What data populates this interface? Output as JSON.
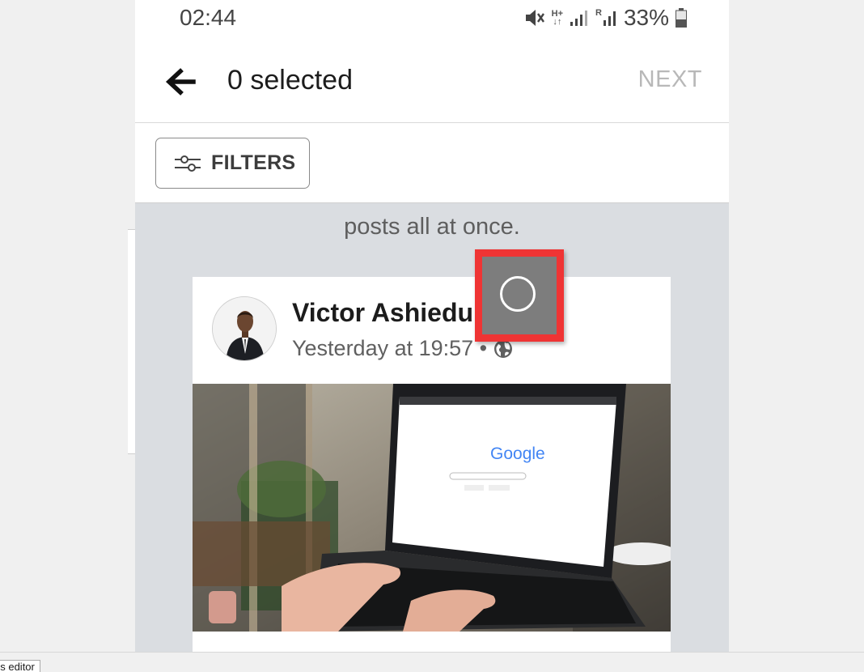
{
  "status_bar": {
    "time": "02:44",
    "network_label": "H+",
    "roaming_label": "R",
    "battery": "33%"
  },
  "app_bar": {
    "title": "0 selected",
    "next_label": "NEXT",
    "back_icon": "arrow-left-icon"
  },
  "filter_bar": {
    "filters_label": "FILTERS",
    "filters_icon": "sliders-icon"
  },
  "feed": {
    "truncated_text": "posts all at once.",
    "post": {
      "author": "Victor Ashiedu",
      "timestamp": "Yesterday at 19:57 •",
      "privacy_icon": "globe-icon",
      "selected": false,
      "image": {
        "screen_brand": "Google"
      }
    }
  },
  "taskbar": {
    "tab_label": "us editor"
  },
  "colors": {
    "highlight": "#ef3434",
    "next_disabled": "#b8b8b8",
    "feed_background": "#dadde1"
  }
}
